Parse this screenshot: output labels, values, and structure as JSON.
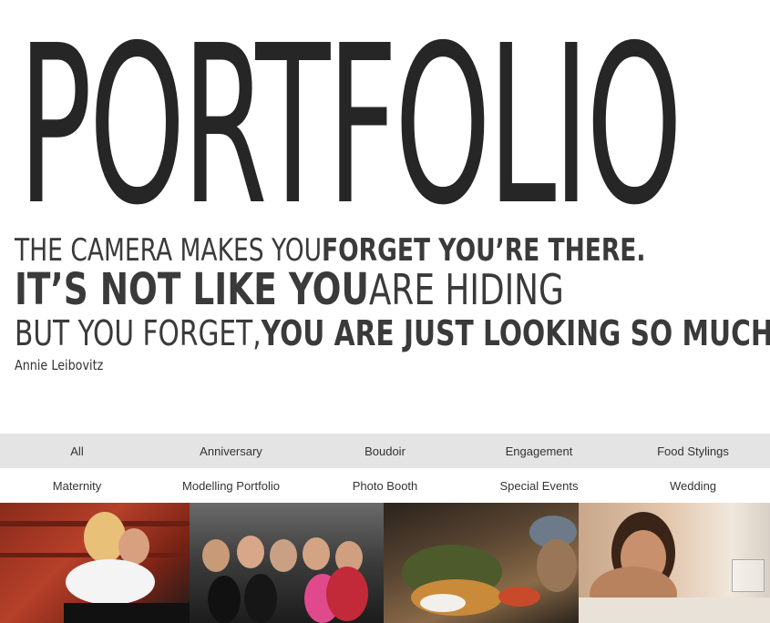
{
  "hero": {
    "title": "PORTFOLIO"
  },
  "quote": {
    "line1_thin": "THE CAMERA MAKES YOU ",
    "line1_bold": "FORGET YOU’RE THERE.",
    "line2_bold": "IT’S NOT LIKE YOU",
    "line2_thin": "ARE HIDING",
    "line3_thin": "BUT YOU FORGET, ",
    "line3_bold": "YOU ARE JUST LOOKING SO MUCH.",
    "author": "Annie Leibovitz"
  },
  "filters": {
    "row1": [
      "All",
      "Anniversary",
      "Boudoir",
      "Engagement",
      "Food Stylings"
    ],
    "row2": [
      "Maternity",
      "Modelling Portfolio",
      "Photo Booth",
      "Special Events",
      "Wedding"
    ]
  },
  "colors": {
    "filter_bar_bg": "#e4e4e4",
    "text": "#2a2a2a"
  }
}
